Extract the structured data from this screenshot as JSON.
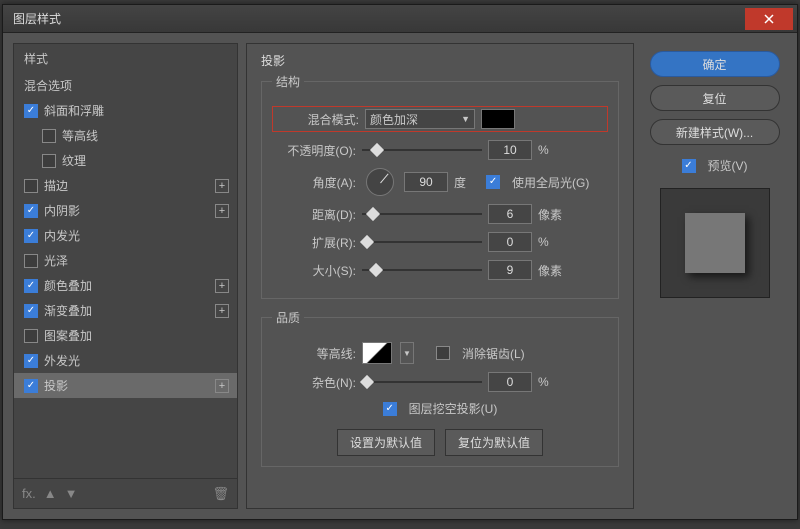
{
  "window": {
    "title": "图层样式"
  },
  "sidebar": {
    "header": "样式",
    "blendingOptions": "混合选项",
    "items": [
      {
        "label": "斜面和浮雕",
        "checked": true,
        "addable": false,
        "sub": false
      },
      {
        "label": "等高线",
        "checked": false,
        "addable": false,
        "sub": true
      },
      {
        "label": "纹理",
        "checked": false,
        "addable": false,
        "sub": true
      },
      {
        "label": "描边",
        "checked": false,
        "addable": true,
        "sub": false
      },
      {
        "label": "内阴影",
        "checked": true,
        "addable": true,
        "sub": false
      },
      {
        "label": "内发光",
        "checked": true,
        "addable": false,
        "sub": false
      },
      {
        "label": "光泽",
        "checked": false,
        "addable": false,
        "sub": false
      },
      {
        "label": "颜色叠加",
        "checked": true,
        "addable": true,
        "sub": false
      },
      {
        "label": "渐变叠加",
        "checked": true,
        "addable": true,
        "sub": false
      },
      {
        "label": "图案叠加",
        "checked": false,
        "addable": false,
        "sub": false
      },
      {
        "label": "外发光",
        "checked": true,
        "addable": false,
        "sub": false
      },
      {
        "label": "投影",
        "checked": true,
        "addable": true,
        "sub": false,
        "selected": true
      }
    ]
  },
  "panel": {
    "title": "投影",
    "structure": {
      "legend": "结构",
      "blendMode": {
        "label": "混合模式:",
        "value": "颜色加深"
      },
      "opacity": {
        "label": "不透明度(O):",
        "value": "10",
        "unit": "%"
      },
      "angle": {
        "label": "角度(A):",
        "value": "90",
        "unit": "度"
      },
      "globalLight": {
        "label": "使用全局光(G)",
        "checked": true
      },
      "distance": {
        "label": "距离(D):",
        "value": "6",
        "unit": "像素"
      },
      "spread": {
        "label": "扩展(R):",
        "value": "0",
        "unit": "%"
      },
      "size": {
        "label": "大小(S):",
        "value": "9",
        "unit": "像素"
      }
    },
    "quality": {
      "legend": "品质",
      "contour": {
        "label": "等高线:"
      },
      "antiAlias": {
        "label": "消除锯齿(L)",
        "checked": false
      },
      "noise": {
        "label": "杂色(N):",
        "value": "0",
        "unit": "%"
      },
      "knockout": {
        "label": "图层挖空投影(U)",
        "checked": true
      }
    },
    "buttons": {
      "setDefault": "设置为默认值",
      "resetDefault": "复位为默认值"
    }
  },
  "right": {
    "ok": "确定",
    "cancel": "复位",
    "newStyle": "新建样式(W)...",
    "preview": {
      "label": "预览(V)",
      "checked": true
    }
  }
}
